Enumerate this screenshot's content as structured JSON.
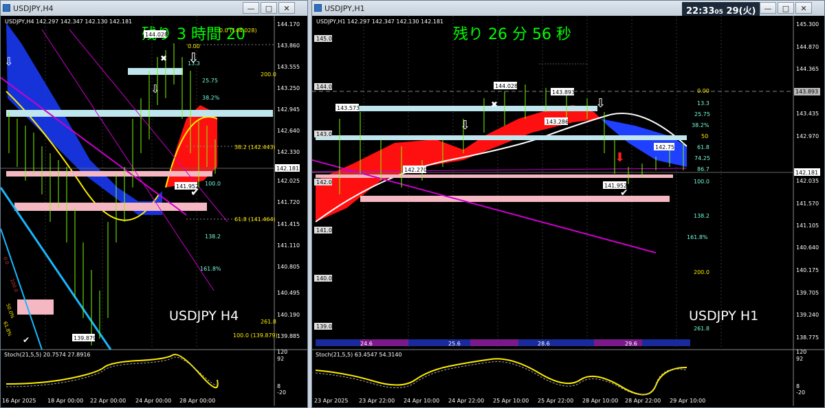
{
  "taskbar": {
    "clock_time": "22:33",
    "clock_sec": "05",
    "clock_date": "29(火)"
  },
  "left": {
    "window_title": "USDJPY,H4",
    "info": "USDJPY,H4  142.297 142.347 142.130 142.181",
    "countdown": "残り 3 時間 20",
    "label": "USDJPY H4",
    "price_labels": [
      "144.170",
      "143.860",
      "143.555",
      "143.250",
      "142.945",
      "142.640",
      "142.330",
      "142.181",
      "142.025",
      "141.720",
      "141.415",
      "141.110",
      "140.805",
      "140.495",
      "140.190",
      "139.885"
    ],
    "fib_labels": [
      "0.0 (144.028)",
      "0.00",
      "13.3",
      "200.0",
      "25.75",
      "38.2%",
      "38.2 (142.443)",
      "100.0",
      "61.8 (141.464)",
      "138.2",
      "161.8%",
      "261.8",
      "100.0 (139.879)"
    ],
    "price_boxes": [
      "144.028",
      "141.952",
      "139.879"
    ],
    "stoch_label": "Stoch(21,5,5) 20.7574 27.8916",
    "stoch_levels": [
      "120",
      "92",
      "8",
      "-20"
    ],
    "time_labels": [
      "16 Apr 2025",
      "18 Apr 00:00",
      "22 Apr 00:00",
      "24 Apr 00:00",
      "28 Apr 00:00"
    ],
    "side_labels": [
      "0.0",
      "50.0%",
      "61.8%",
      "100.0"
    ]
  },
  "right": {
    "window_title": "USDJPY,H1",
    "info": "USDJPY,H1  142.297 142.347 142.130 142.181",
    "countdown_a": "残り",
    "countdown_b": "26",
    "countdown_c": "分",
    "countdown_d": "56",
    "countdown_e": "秒",
    "label": "USDJPY H1",
    "price_labels": [
      "145.300",
      "144.870",
      "144.365",
      "143.893",
      "143.435",
      "142.970",
      "142.181",
      "142.035",
      "141.570",
      "141.105",
      "140.640",
      "140.175",
      "139.705",
      "139.240",
      "138.775"
    ],
    "level_boxes": [
      "145.0",
      "144.0",
      "143.0",
      "142.0",
      "141.0",
      "140.0",
      "139.0"
    ],
    "fib_labels": [
      "0.00",
      "13.3",
      "25.75",
      "38.2%",
      "50",
      "61.8",
      "74.25",
      "86.7",
      "100.0",
      "138.2",
      "161.8%",
      "200.0",
      "261.8"
    ],
    "price_boxes": [
      "144.028",
      "143.893",
      "143.573",
      "143.286",
      "142.270",
      "142.75",
      "141.952"
    ],
    "date_strip": [
      "24.6",
      "25.6",
      "28.6",
      "29.6"
    ],
    "stoch_label": "Stoch(21,5,5) 63.4547 54.3140",
    "stoch_levels": [
      "120",
      "92",
      "8",
      "-20"
    ],
    "time_labels": [
      "23 Apr 2025",
      "23 Apr 22:00",
      "24 Apr 10:00",
      "24 Apr 22:00",
      "25 Apr 10:00",
      "25 Apr 22:00",
      "28 Apr 10:00",
      "28 Apr 22:00",
      "29 Apr 10:00"
    ]
  },
  "colors": {
    "countdown": "#00ff00",
    "bull": "#7cfc00",
    "cloud_red": "#ff0000",
    "cloud_blue": "#0033ff",
    "stoch": "#ffee00"
  }
}
